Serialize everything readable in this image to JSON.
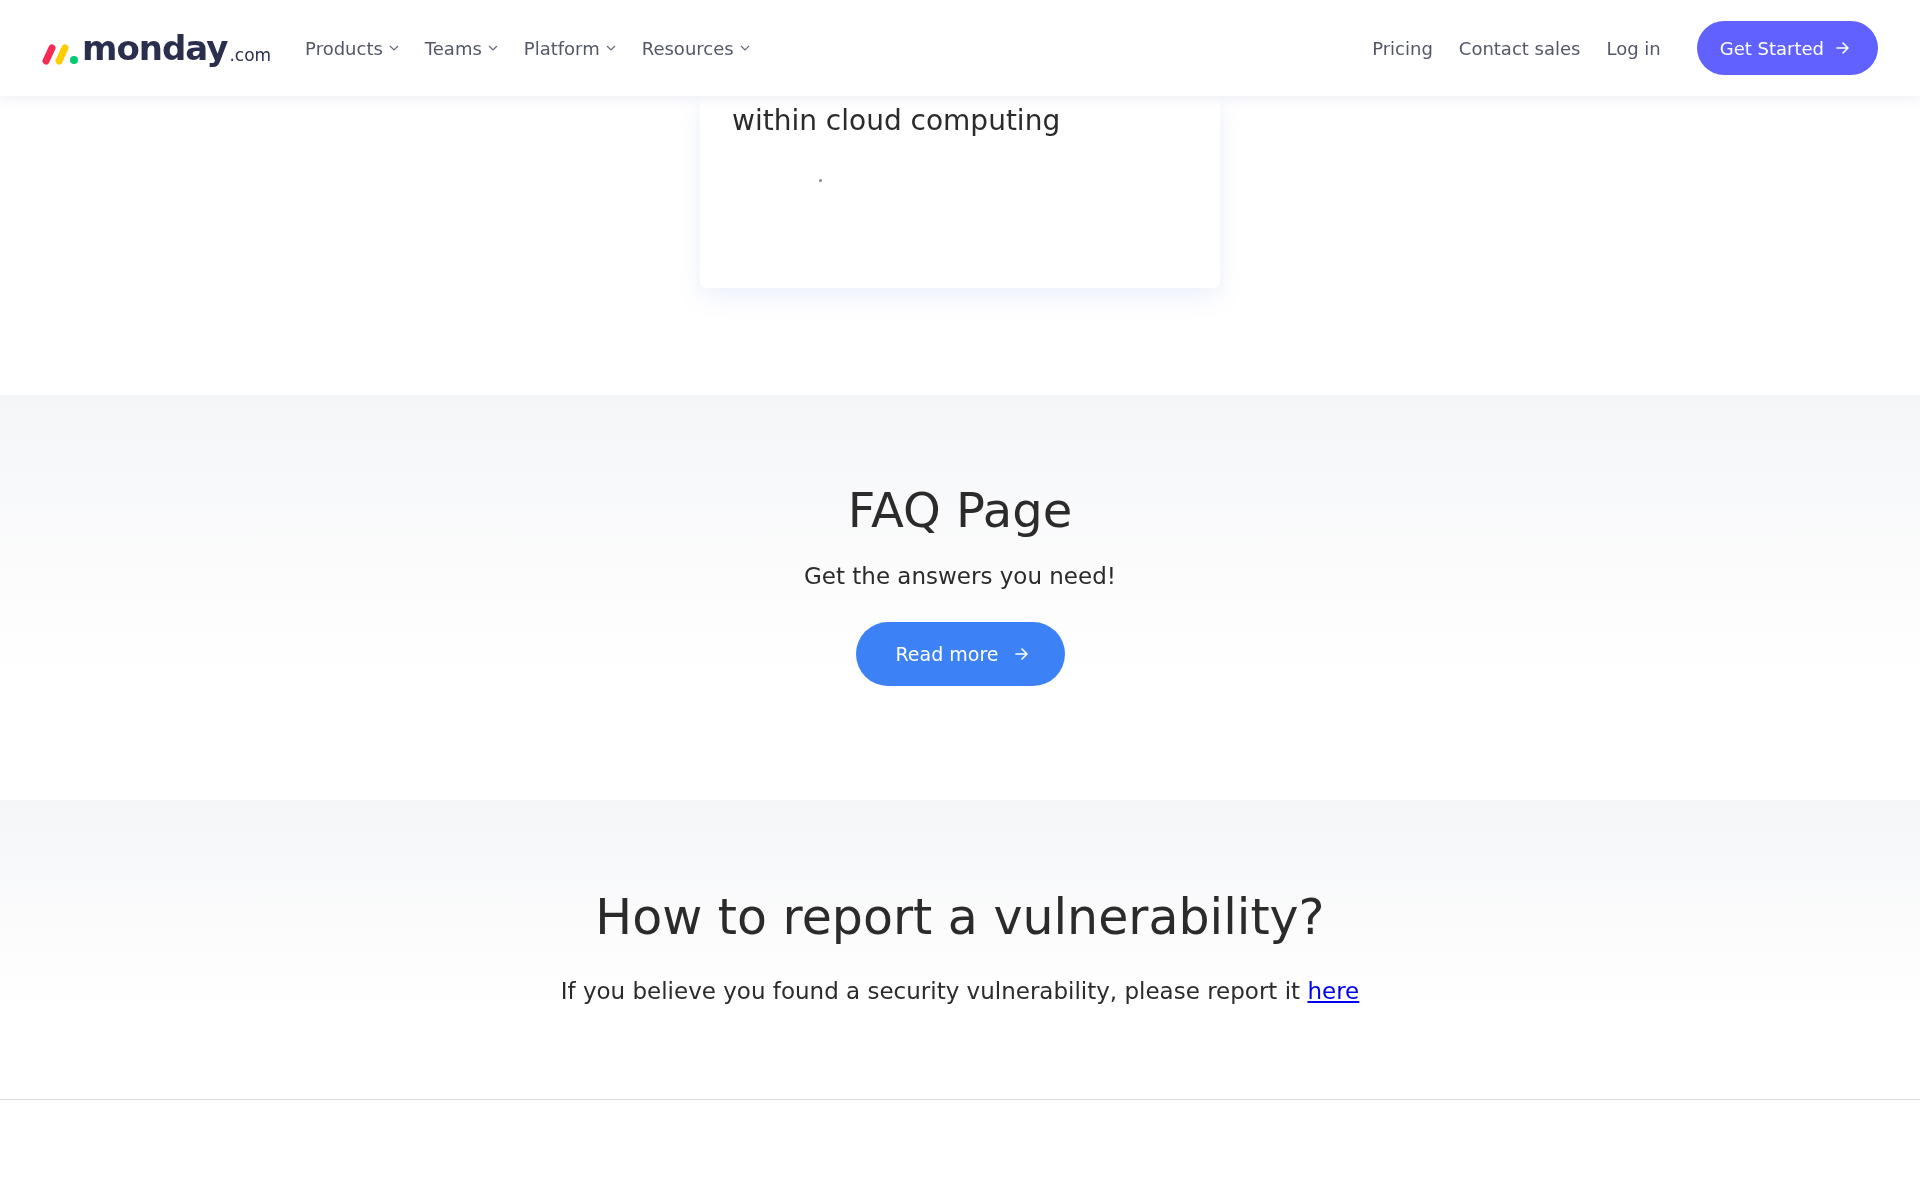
{
  "header": {
    "logo": {
      "wordmark": "monday",
      "suffix": ".com"
    },
    "nav": [
      {
        "label": "Products",
        "dropdown": true
      },
      {
        "label": "Teams",
        "dropdown": true
      },
      {
        "label": "Platform",
        "dropdown": true
      },
      {
        "label": "Resources",
        "dropdown": true
      }
    ],
    "links": [
      "Pricing",
      "Contact sales",
      "Log in"
    ],
    "cta": {
      "label": "Get Started"
    }
  },
  "card": {
    "text": "within cloud computing"
  },
  "faq": {
    "title": "FAQ Page",
    "subtitle": "Get the answers you need!",
    "button": "Read more"
  },
  "vulnerability": {
    "title": "How to report a vulnerability?",
    "text": "If you believe you found a security vulnerability, please report it",
    "link": "here"
  }
}
